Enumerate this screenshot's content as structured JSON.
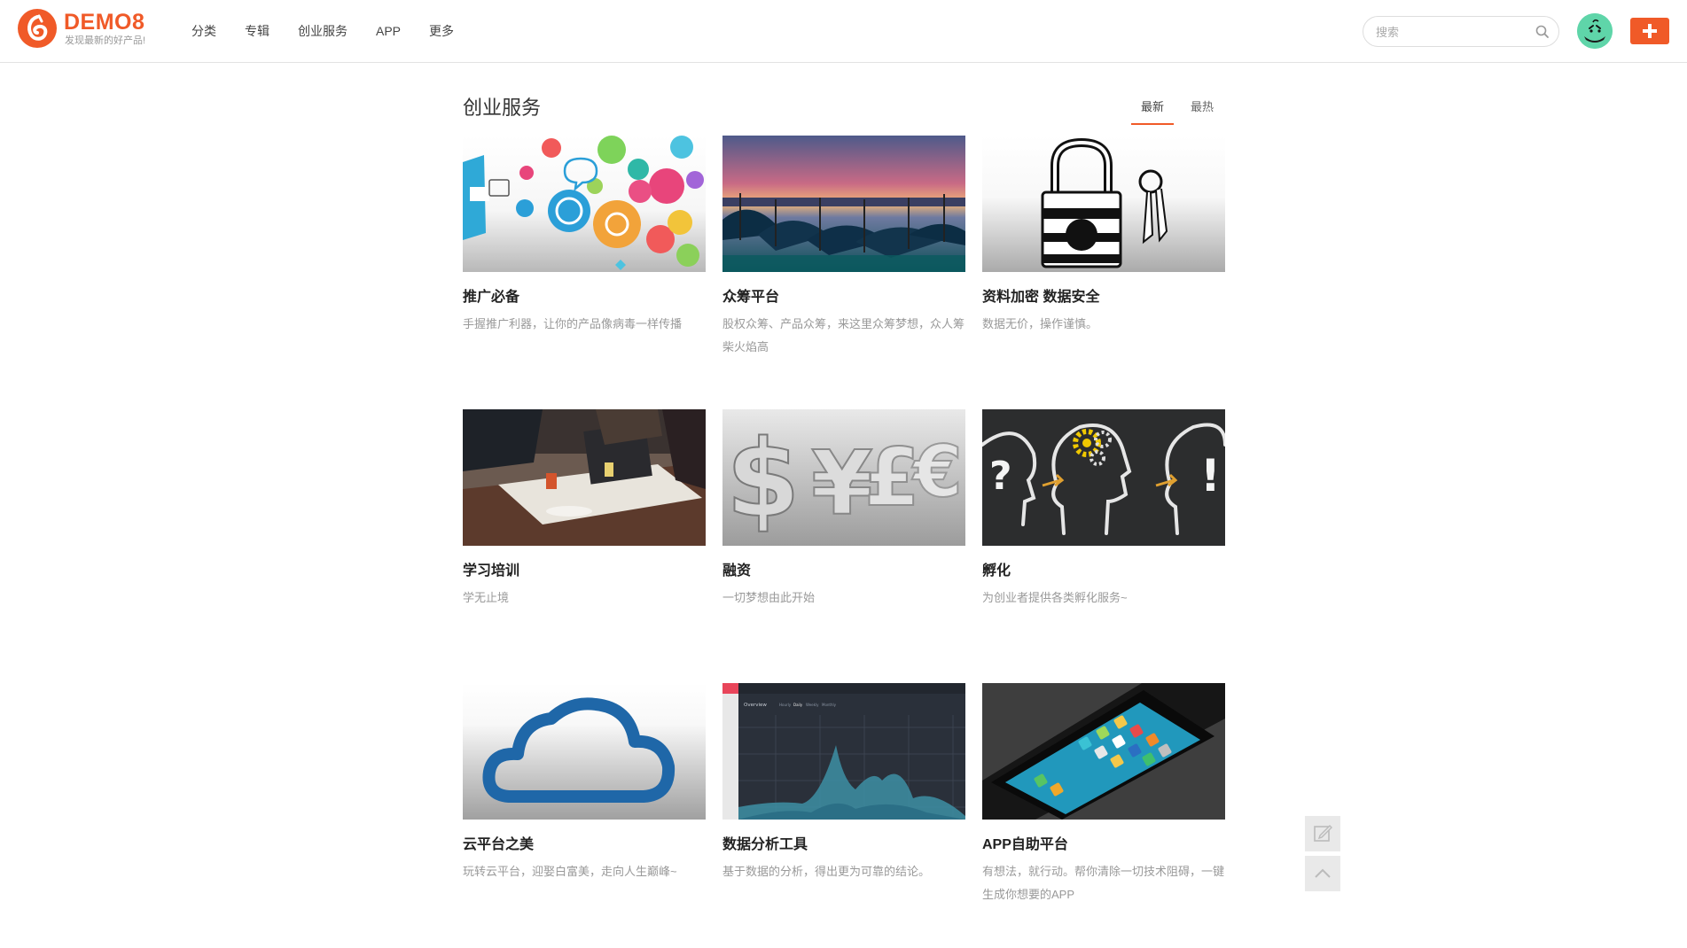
{
  "brand": {
    "name": "DEMO8",
    "slogan": "发现最新的好产品!"
  },
  "nav": [
    "分类",
    "专辑",
    "创业服务",
    "APP",
    "更多"
  ],
  "search": {
    "placeholder": "搜索"
  },
  "section": {
    "title": "创业服务",
    "tabs": [
      "最新",
      "最热"
    ],
    "active_tab": "最新"
  },
  "cards": [
    {
      "title": "推广必备",
      "desc": "手握推广利器，让你的产品像病毒一样传播"
    },
    {
      "title": "众筹平台",
      "desc": "股权众筹、产品众筹，来这里众筹梦想，众人筹柴火焰高"
    },
    {
      "title": "资料加密 数据安全",
      "desc": "数据无价，操作谨慎。"
    },
    {
      "title": "学习培训",
      "desc": "学无止境"
    },
    {
      "title": "融资",
      "desc": "一切梦想由此开始"
    },
    {
      "title": "孵化",
      "desc": "为创业者提供各类孵化服务~"
    },
    {
      "title": "云平台之美",
      "desc": "玩转云平台，迎娶白富美，走向人生巅峰~"
    },
    {
      "title": "数据分析工具",
      "desc": "基于数据的分析，得出更为可靠的结论。"
    },
    {
      "title": "APP自助平台",
      "desc": "有想法，就行动。帮你清除一切技术阻碍，一键生成你想要的APP"
    }
  ],
  "chart_thumb": {
    "label": "Overview",
    "periods": [
      "Hourly",
      "Daily",
      "Weekly",
      "Monthly"
    ]
  },
  "icons": {
    "search": "search-icon",
    "add": "plus-icon",
    "edit": "edit-icon",
    "top": "chevron-up-icon"
  },
  "colors": {
    "accent": "#f05a28",
    "avatar_bg": "#5fd5a9"
  }
}
